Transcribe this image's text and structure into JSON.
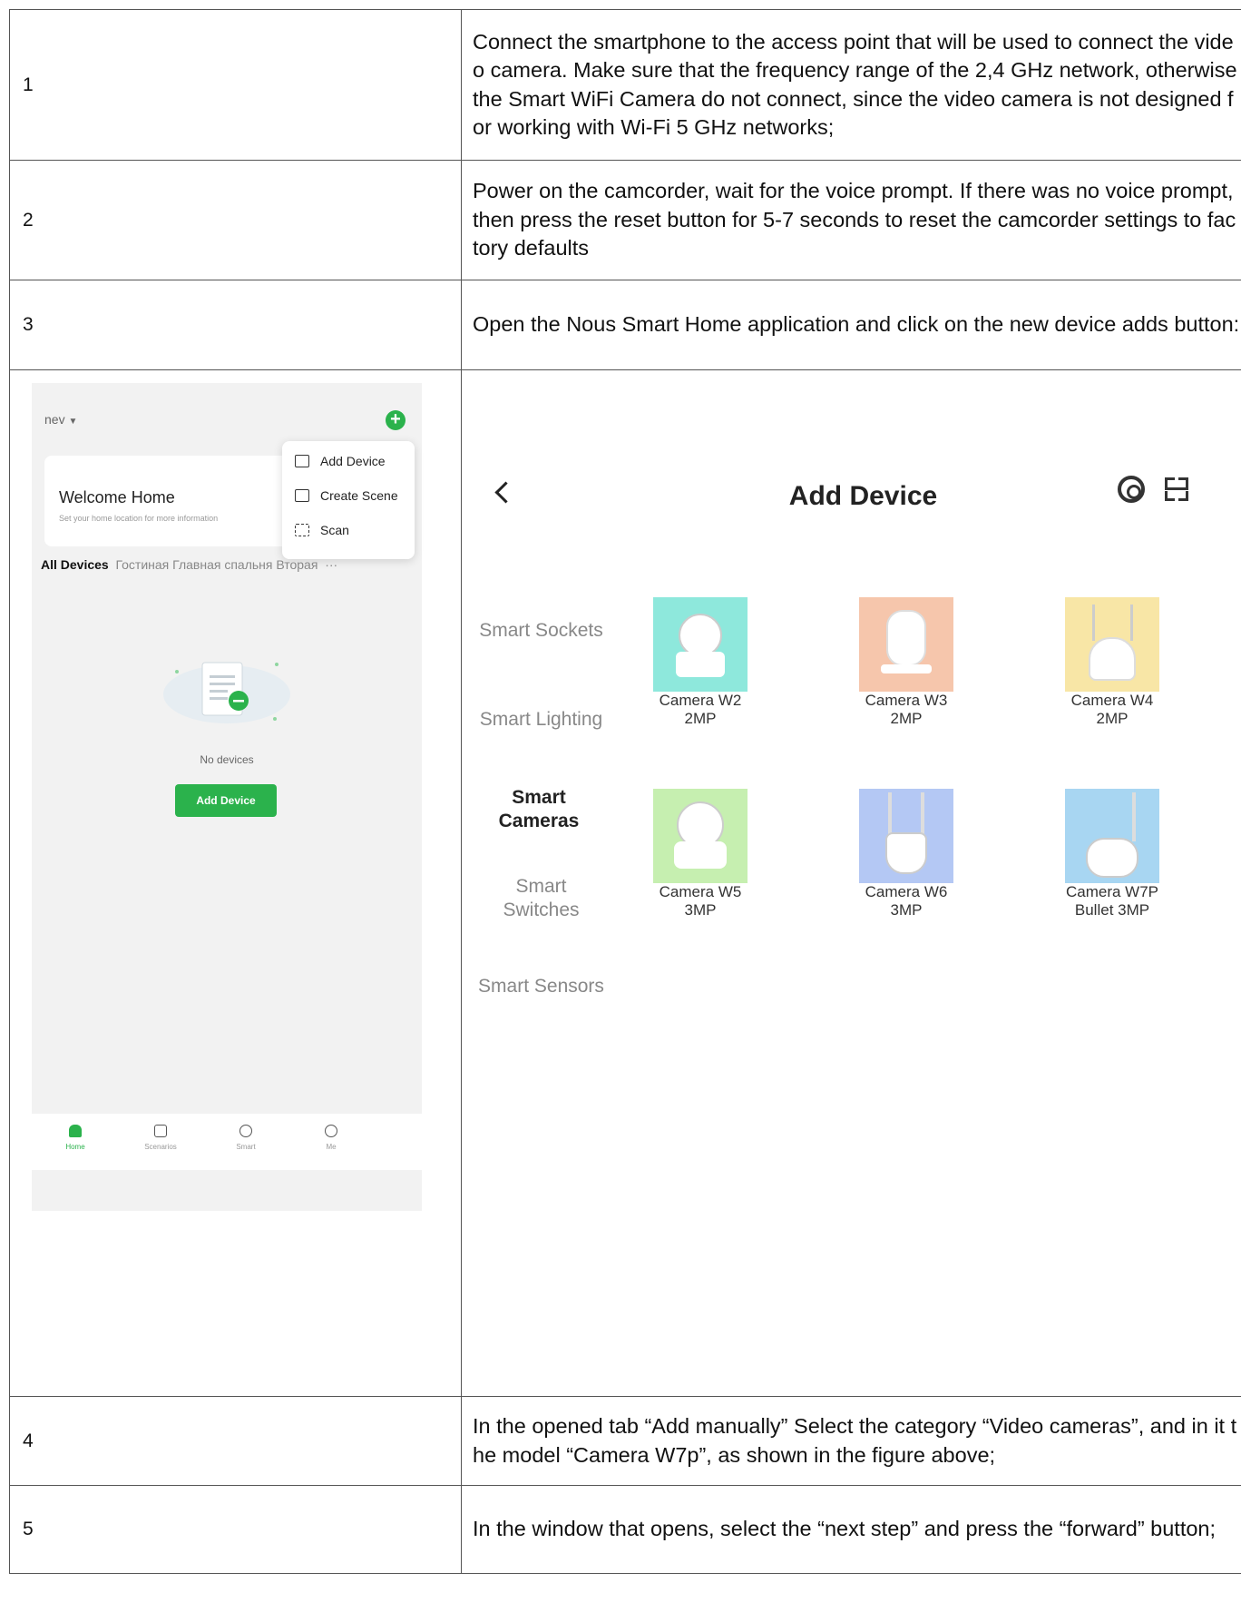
{
  "rows": [
    {
      "num": "1",
      "text": "Connect the smartphone to the access point that will be used to connect the video camera. Make sure that the frequency range of the 2,4 GHz network, otherwise the Smart WiFi Camera do not connect, since the video camera is not designed for working with Wi-Fi 5 GHz networks;"
    },
    {
      "num": "2",
      "text": "Power on the camcorder, wait for the voice prompt. If there was no voice prompt, then press the reset button for 5-7 seconds to reset the camcorder settings to factory defaults"
    },
    {
      "num": "3",
      "text": "Open the Nous Smart Home application and click on the new device adds button:"
    },
    {
      "num": "4",
      "text": "In the opened tab “Add manually” Select the category “Video cameras”, and in it the model “Camera W7p”, as shown in the figure above;"
    },
    {
      "num": "5",
      "text": "In the window that opens, select the “next step” and press the “forward” button;"
    }
  ],
  "phone": {
    "home_name": "nev",
    "welcome_title": "Welcome Home",
    "welcome_sub": "Set your home location for more information",
    "menu": [
      "Add Device",
      "Create Scene",
      "Scan"
    ],
    "tabs_selected": "All Devices",
    "tabs_other": "Гостиная   Главная спальня   Вторая",
    "more": "···",
    "empty_text": "No devices",
    "add_button": "Add Device",
    "nav": [
      "Home",
      "Scenarios",
      "Smart",
      "Me"
    ],
    "accent": "#2bb24c"
  },
  "add_device": {
    "title": "Add Device",
    "categories": [
      "Smart Sockets",
      "Smart Lighting",
      "Smart Cameras",
      "Smart Switches",
      "Smart Sensors"
    ],
    "selected_category": "Smart Cameras",
    "devices": [
      {
        "line1": "Camera W2",
        "line2": "2MP",
        "bg": "#8ee8dc"
      },
      {
        "line1": "Camera W3",
        "line2": "2MP",
        "bg": "#f6c6ac"
      },
      {
        "line1": "Camera W4",
        "line2": "2MP",
        "bg": "#f8e6a6"
      },
      {
        "line1": "Camera W5",
        "line2": "3MP",
        "bg": "#c6efb0"
      },
      {
        "line1": "Camera W6",
        "line2": "3MP",
        "bg": "#b4c8f4"
      },
      {
        "line1": "Camera W7P",
        "line2": "Bullet 3MP",
        "bg": "#a8d6f2"
      }
    ]
  }
}
